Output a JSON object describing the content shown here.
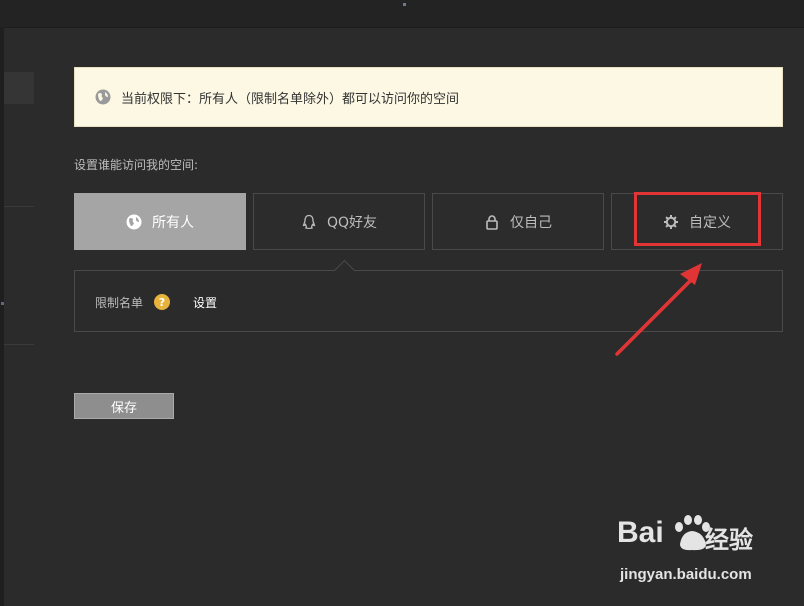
{
  "notice": {
    "text": "当前权限下：所有人（限制名单除外）都可以访问你的空间",
    "icon": "globe-icon"
  },
  "section_label": "设置谁能访问我的空间:",
  "tabs": [
    {
      "label": "所有人",
      "icon": "globe-icon",
      "active": true
    },
    {
      "label": "QQ好友",
      "icon": "qq-penguin-icon",
      "active": false
    },
    {
      "label": "仅自己",
      "icon": "lock-icon",
      "active": false
    },
    {
      "label": "自定义",
      "icon": "gear-icon",
      "active": false
    }
  ],
  "restriction": {
    "label": "限制名单",
    "help_icon": "?",
    "settings_link": "设置"
  },
  "save_label": "保存",
  "colors": {
    "annotation": "#e13535",
    "active_tab": "#a5a5a5",
    "notice_bg": "#fdf8e4"
  },
  "watermark": {
    "logo_text": "Bai",
    "logo_cn": "经验",
    "url": "jingyan.baidu.com"
  }
}
